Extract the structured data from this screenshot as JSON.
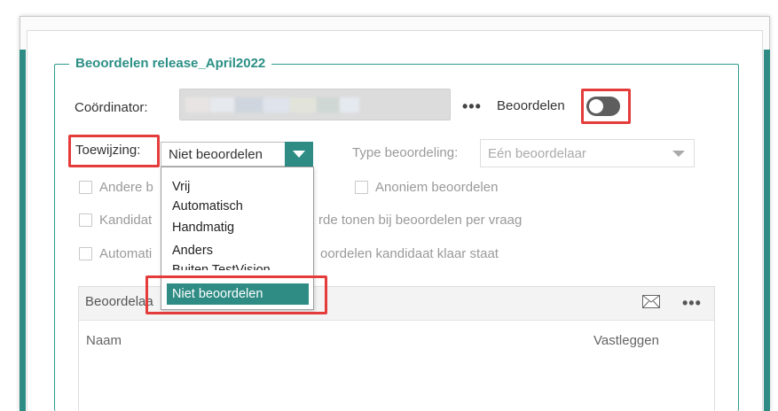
{
  "dialog": {
    "section_title": "Beoordelen release_April2022"
  },
  "coordinator": {
    "label": "Coördinator:",
    "more_label": "•••"
  },
  "beoordelen": {
    "label": "Beoordelen",
    "toggle_on": false
  },
  "toewijzing": {
    "label": "Toewijzing:",
    "selected": "Niet beoordelen",
    "options": [
      "Vrij",
      "Automatisch",
      "Handmatig",
      "Anders",
      "Buiten TestVision",
      "Niet beoordelen"
    ]
  },
  "type_beoordeling": {
    "label": "Type beoordeling:",
    "selected": "Eén beoordelaar"
  },
  "checkboxes": {
    "andere": "Andere b",
    "anoniem": "Anoniem beoordelen",
    "kandidaat_left": "Kandidat",
    "kandidaat_right": "rde tonen bij beoordelen per vraag",
    "automatisch_left": "Automati",
    "automatisch_right": "oordelen kandidaat klaar staat"
  },
  "panel": {
    "title": "Beoordelaa",
    "more_label": "•••",
    "col_name": "Naam",
    "col_vastleggen": "Vastleggen"
  },
  "colors": {
    "accent": "#2e8c85",
    "highlight": "#e43b3b",
    "toggle_off": "#5e5e5e"
  },
  "icons": [
    "ellipsis-icon",
    "dropdown-arrow-icon",
    "checkbox-icon",
    "mail-icon"
  ]
}
